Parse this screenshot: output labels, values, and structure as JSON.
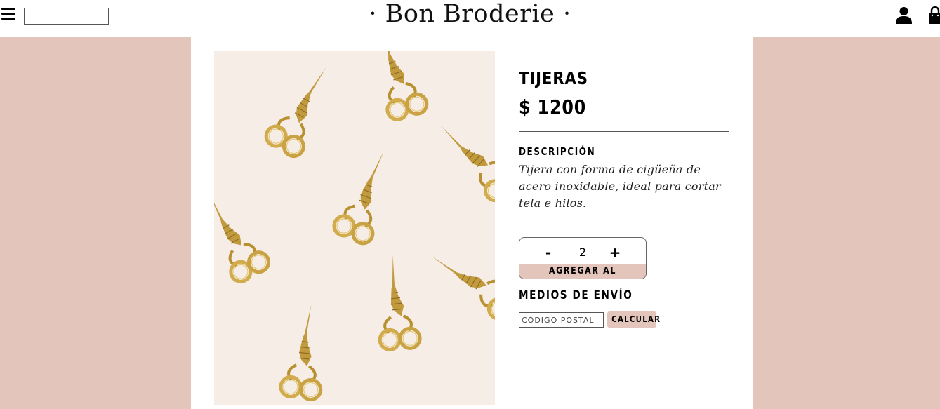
{
  "header": {
    "brand": "· Bon Broderie ·",
    "search": {
      "value": "",
      "placeholder": ""
    }
  },
  "product": {
    "title": "TIJERAS",
    "price": "$ 1200",
    "image_alt": "Tijeras doradas con forma de cigüeña",
    "description_heading": "DESCRIPCIÓN",
    "description": "Tijera con forma de cigüeña de acero inoxidable, ideal para cortar tela e hilos."
  },
  "purchase": {
    "minus": "-",
    "quantity": "2",
    "plus": "+",
    "add_to_cart": "AGREGAR AL CARRITO"
  },
  "shipping": {
    "heading": "MEDIOS DE ENVÍO",
    "zip_placeholder": "CÓDIGO POSTAL",
    "zip_value": "",
    "calculate": "CALCULAR"
  },
  "icons": {
    "menu": "hamburger-menu-icon",
    "user": "user-icon",
    "cart": "shopping-bag-icon"
  },
  "colors": {
    "accent": "#e3c5bb",
    "text": "#000000",
    "photo_background": "#f5ede6",
    "scissors_gold": "#c9a243"
  }
}
